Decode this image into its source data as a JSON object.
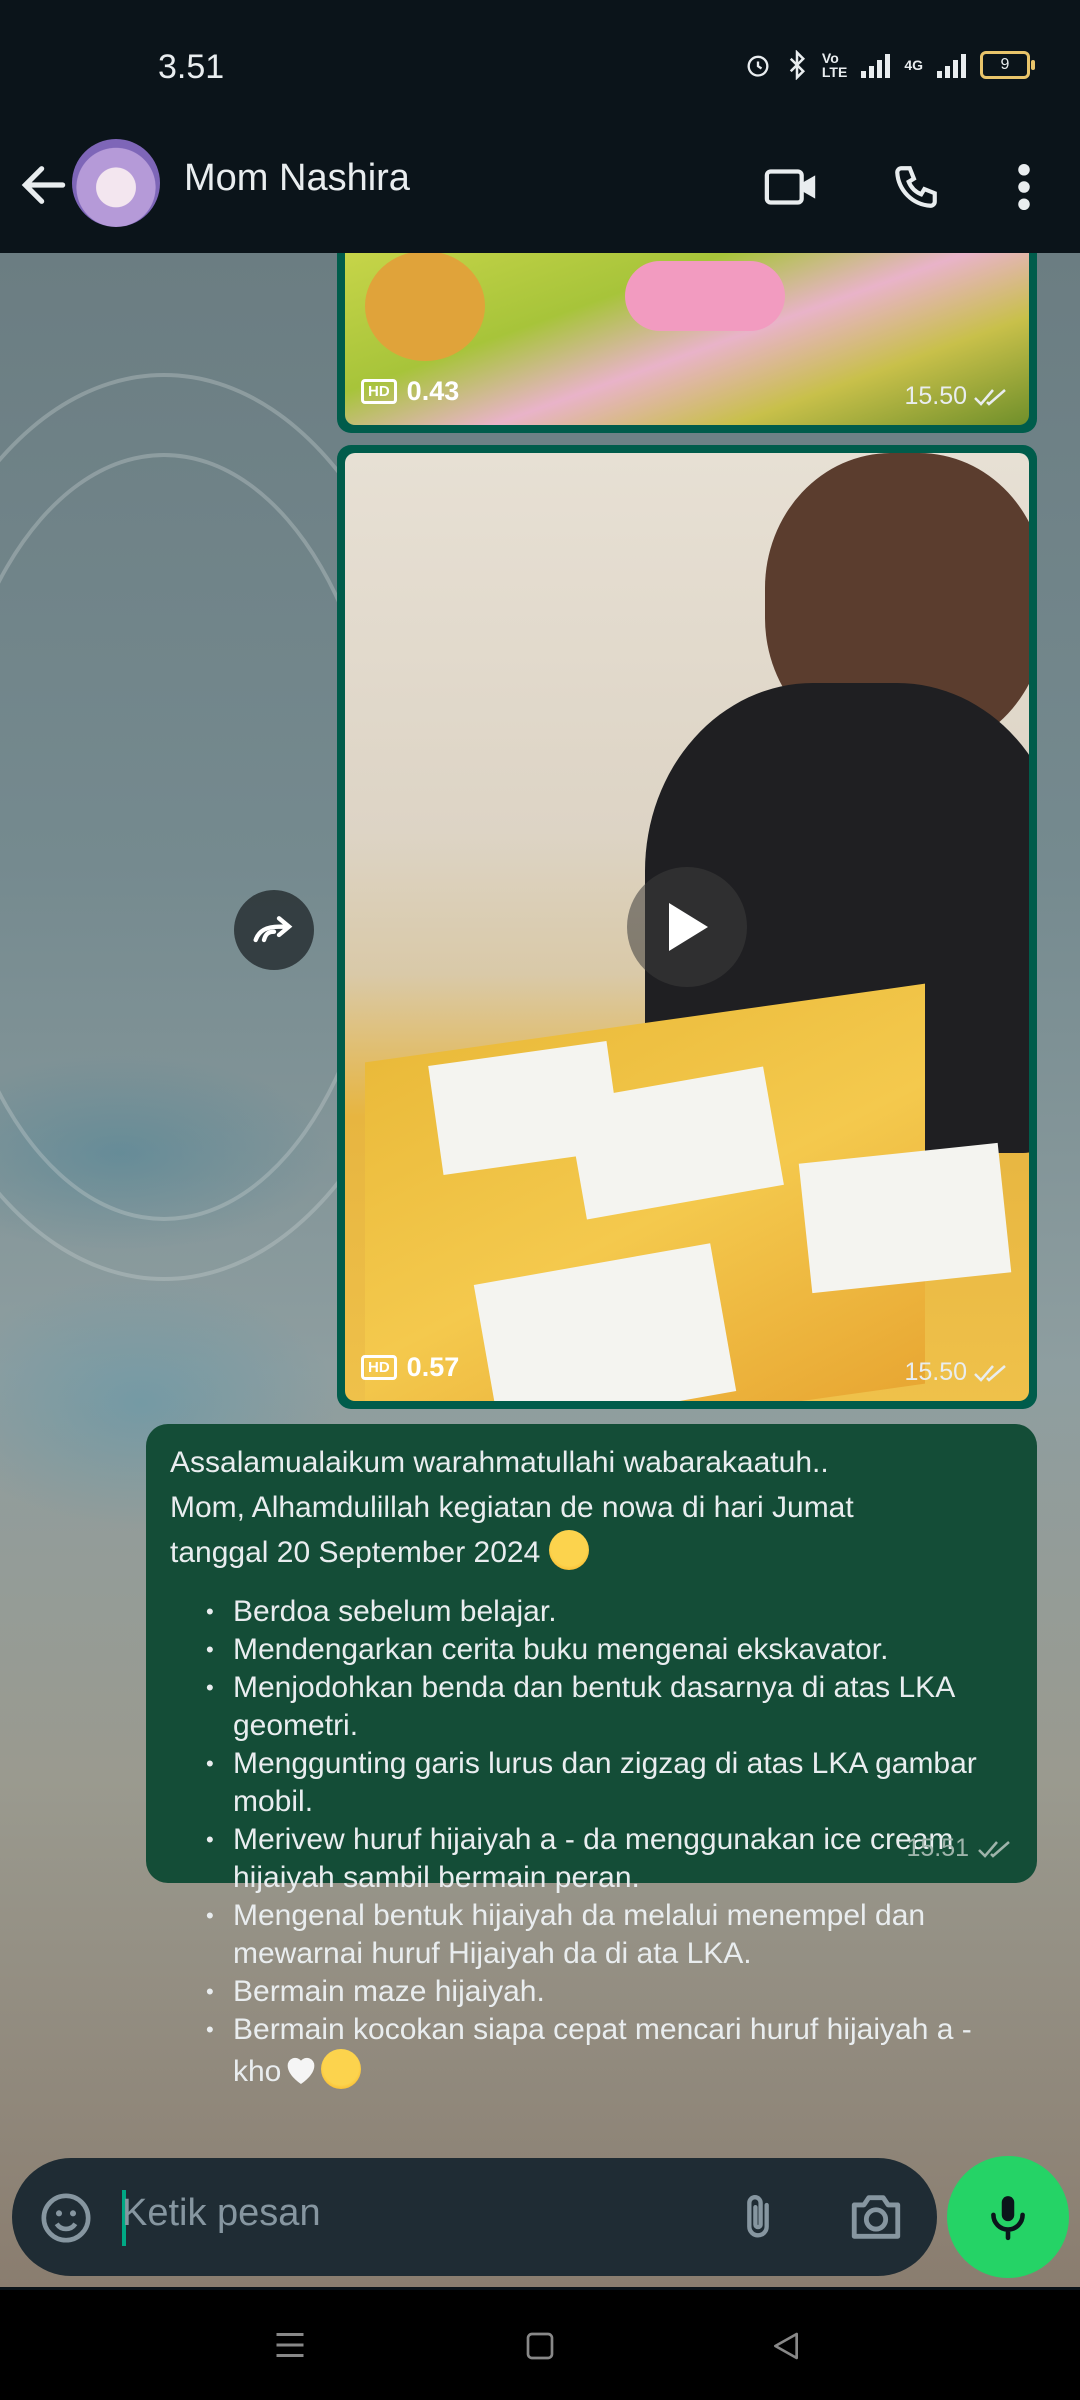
{
  "status_bar": {
    "time": "3.51",
    "battery": "9",
    "signal_label": "4G",
    "volte_label": "VoLTE"
  },
  "header": {
    "contact_name": "Mom Nashira"
  },
  "messages": {
    "video1": {
      "duration": "0.43",
      "time": "15.50",
      "hd_label": "HD"
    },
    "video2": {
      "duration": "0.57",
      "time": "15.50",
      "hd_label": "HD"
    },
    "text_message": {
      "line1": "Assalamualaikum warahmatullahi wabarakaatuh..",
      "line2": "Mom, Alhamdulillah kegiatan de nowa di hari Jumat",
      "line3": "tanggal 20 September 2024",
      "items": [
        "Berdoa sebelum belajar.",
        "Mendengarkan cerita buku mengenai ekskavator.",
        "Menjodohkan benda dan bentuk dasarnya di atas LKA geometri.",
        "Menggunting garis lurus dan zigzag di atas LKA gambar mobil.",
        "Merivew huruf hijaiyah a - da menggunakan ice cream hijaiyah sambil bermain peran.",
        "Mengenal bentuk hijaiyah da melalui menempel dan mewarnai huruf Hijaiyah da di ata LKA.",
        "Bermain maze hijaiyah.",
        "Bermain kocokan siapa cepat mencari huruf hijaiyah a - kho"
      ],
      "time": "15.51"
    }
  },
  "composer": {
    "placeholder": "Ketik pesan"
  },
  "colors": {
    "outgoing_bubble": "#144d37",
    "video_border": "#005c4b",
    "accent": "#25d366"
  }
}
